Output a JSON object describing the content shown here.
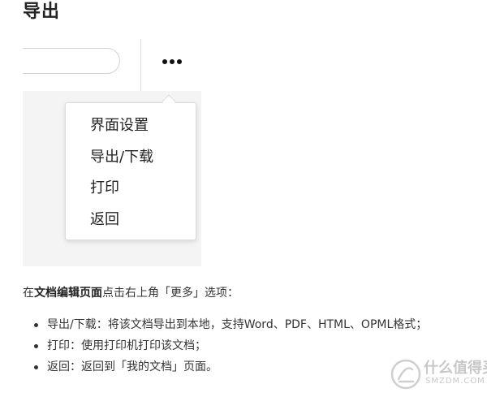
{
  "heading": "导出",
  "screenshot": {
    "menu_items": [
      "界面设置",
      "导出/下载",
      "打印",
      "返回"
    ]
  },
  "intro": {
    "prefix": "在",
    "bold": "文档编辑页面",
    "suffix": "点击右上角「更多」选项："
  },
  "bullets": [
    "导出/下载：将该文档导出到本地，支持Word、PDF、HTML、OPML格式；",
    "打印：使用打印机打印该文档；",
    "返回：返回到「我的文档」页面。"
  ],
  "watermark": {
    "cn": "什么值得买",
    "en": "SMZDM.COM"
  }
}
